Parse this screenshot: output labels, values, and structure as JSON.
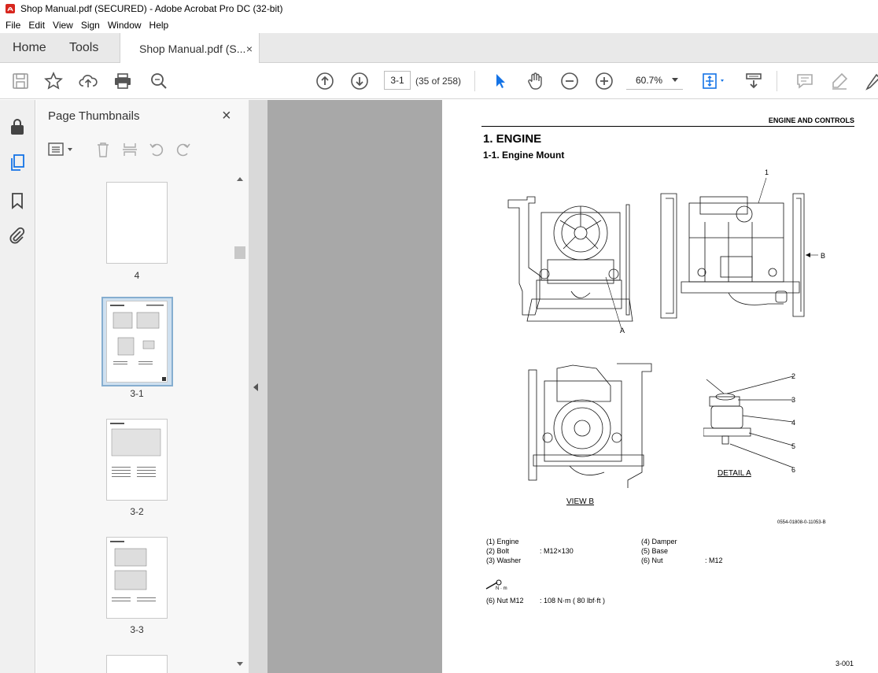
{
  "window": {
    "title": "Shop Manual.pdf (SECURED) - Adobe Acrobat Pro DC (32-bit)"
  },
  "menu": [
    "File",
    "Edit",
    "View",
    "Sign",
    "Window",
    "Help"
  ],
  "tabs": {
    "home": "Home",
    "tools": "Tools",
    "doc": "Shop Manual.pdf (S...",
    "close": "×"
  },
  "toolbar": {
    "page_current": "3-1",
    "page_count": "(35 of 258)",
    "zoom": "60.7%"
  },
  "thumbnails": {
    "title": "Page Thumbnails",
    "close": "×",
    "pages": [
      "4",
      "3-1",
      "3-2",
      "3-3"
    ]
  },
  "document": {
    "header": "ENGINE AND CONTROLS",
    "section": "1. ENGINE",
    "subsection": "1-1. Engine Mount",
    "callouts": {
      "c1": "1",
      "cA": "A",
      "cB": "B",
      "c2": "2",
      "c3": "3",
      "c4": "4",
      "c5": "5",
      "c6": "6"
    },
    "view_b": "VIEW B",
    "detail_a": "DETAIL A",
    "figure_code": "0554-01808-0-11053-B",
    "parts": [
      {
        "label": "(1) Engine",
        "spec": ""
      },
      {
        "label": "(2) Bolt",
        "spec": ": M12×130"
      },
      {
        "label": "(3) Washer",
        "spec": ""
      },
      {
        "label": "(4) Damper",
        "spec": ""
      },
      {
        "label": "(5) Base",
        "spec": ""
      },
      {
        "label": "(6) Nut",
        "spec": ": M12"
      }
    ],
    "torque": {
      "label": "(6) Nut M12",
      "value": ": 108  N·m (   80  lbf·ft  )",
      "unit_icon": "N · m"
    },
    "page_number": "3-001"
  },
  "colors": {
    "accent": "#1473e6",
    "panel": "#f7f7f7",
    "viewer_bg": "#a8a8a8",
    "selection": "#cfe0ef"
  }
}
